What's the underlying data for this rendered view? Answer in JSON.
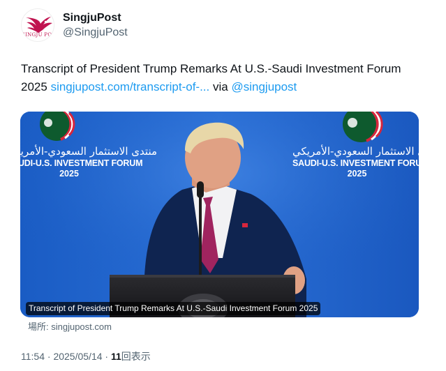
{
  "account": {
    "display_name": "SingjuPost",
    "handle": "@SingjuPost",
    "avatar_text": "SINGJU POST",
    "avatar_icon": "eagle-logo-icon"
  },
  "tweet": {
    "text": "Transcript of President Trump Remarks At U.S.-Saudi Investment Forum 2025",
    "link_text": "singjupost.com/transcript-of-...",
    "via_text": "via",
    "mention": "@singjupost"
  },
  "card": {
    "banner_left": {
      "arabic": "منتدى الاستثمار السعودي-الأمريكي",
      "english": "SAUDI-U.S. INVESTMENT FORUM",
      "year": "2025"
    },
    "banner_right": {
      "arabic": "منتدى الاستثمار السعودي-الأمريكي",
      "english": "SAUDI-U.S. INVESTMENT FORUM",
      "year": "2025"
    },
    "caption": "Transcript of President Trump Remarks At U.S.-Saudi Investment Forum 2025",
    "source": "場所: singjupost.com"
  },
  "meta": {
    "time": "11:54",
    "separator": "·",
    "date": "2025/05/14",
    "views_count": "11",
    "views_label": "回表示"
  },
  "colors": {
    "link": "#1d9bf0",
    "secondary_text": "#536471",
    "card_background": "#1c5fc6",
    "brand": "#c0134f"
  }
}
